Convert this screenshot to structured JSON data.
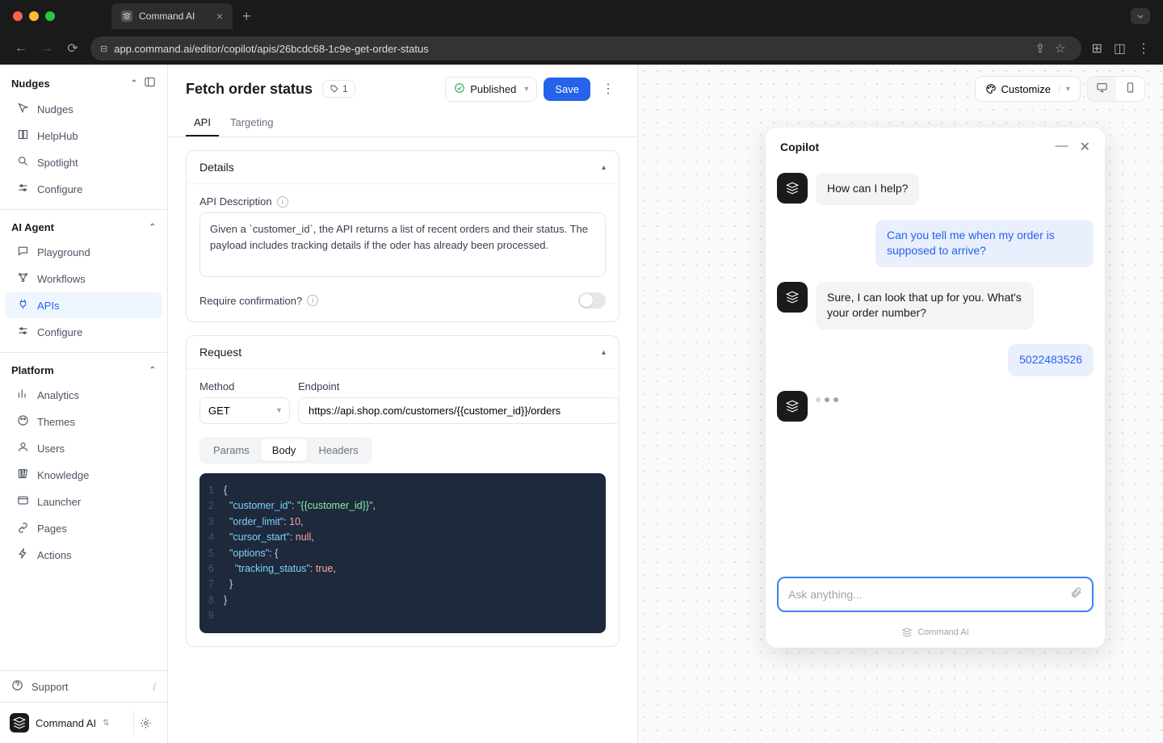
{
  "browser": {
    "tab_title": "Command AI",
    "url_display": "app.command.ai/editor/copilot/apis/26bcdc68-1c9e-get-order-status"
  },
  "sidebar": {
    "sections": [
      {
        "title": "Nudges",
        "items": [
          "Nudges",
          "HelpHub",
          "Spotlight",
          "Configure"
        ]
      },
      {
        "title": "AI Agent",
        "items": [
          "Playground",
          "Workflows",
          "APIs",
          "Configure"
        ]
      },
      {
        "title": "Platform",
        "items": [
          "Analytics",
          "Themes",
          "Users",
          "Knowledge",
          "Launcher",
          "Pages",
          "Actions"
        ]
      }
    ],
    "support": "Support",
    "org_name": "Command AI"
  },
  "editor": {
    "title": "Fetch order status",
    "tag_count": "1",
    "publish_label": "Published",
    "save_label": "Save",
    "tabs": [
      "API",
      "Targeting"
    ],
    "details": {
      "panel_title": "Details",
      "api_desc_label": "API Description",
      "api_desc_value": "Given a `customer_id`, the API returns a list of recent orders and their status. The payload includes tracking details if the oder has already been processed.",
      "confirm_label": "Require confirmation?",
      "confirm_value": false
    },
    "request": {
      "panel_title": "Request",
      "method_label": "Method",
      "method_value": "GET",
      "endpoint_label": "Endpoint",
      "endpoint_value": "https://api.shop.com/customers/{{customer_id}}/orders",
      "body_tabs": [
        "Params",
        "Body",
        "Headers"
      ],
      "body_json": {
        "customer_id": "{{customer_id}}",
        "order_limit": 10,
        "cursor_start": null,
        "options": {
          "tracking_status": true
        }
      }
    }
  },
  "preview": {
    "customize_label": "Customize"
  },
  "copilot": {
    "title": "Copilot",
    "messages": [
      {
        "role": "assistant",
        "text": "How can I help?"
      },
      {
        "role": "user",
        "text": "Can you tell me when my order is supposed to arrive?"
      },
      {
        "role": "assistant",
        "text": "Sure, I can look that up for you. What's your order number?"
      },
      {
        "role": "user",
        "text": "5022483526"
      }
    ],
    "input_placeholder": "Ask anything...",
    "footer": "Command AI"
  }
}
